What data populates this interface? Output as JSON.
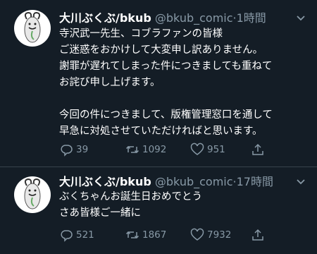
{
  "tweets": [
    {
      "name": "大川ぶくぶ/bkub",
      "handle": "@bkub_comic",
      "time": "1時間",
      "lines": [
        "寺沢武一先生、コブラファンの皆様",
        "ご迷惑をおかけして大変申し訳ありません。",
        "謝罪が遅れてしまった件につきましても重ねて",
        "お詫び申し上げます。",
        "",
        "今回の件につきまして、版権管理窓口を通して",
        "早急に対処させていただければと思います。"
      ],
      "replies": "39",
      "retweets": "1092",
      "likes": "951"
    },
    {
      "name": "大川ぶくぶ/bkub",
      "handle": "@bkub_comic",
      "time": "17時間",
      "lines": [
        "ぶくちゃんお誕生日おめでとう",
        "さあ皆様ご一緒に"
      ],
      "replies": "521",
      "retweets": "1867",
      "likes": "7932"
    }
  ],
  "icons": [
    "avatar",
    "chevron-down-icon",
    "reply-icon",
    "retweet-icon",
    "like-icon",
    "share-icon"
  ],
  "colors": {
    "background": "#141d26",
    "secondary_text": "#8899a6",
    "divider": "#38444d"
  }
}
